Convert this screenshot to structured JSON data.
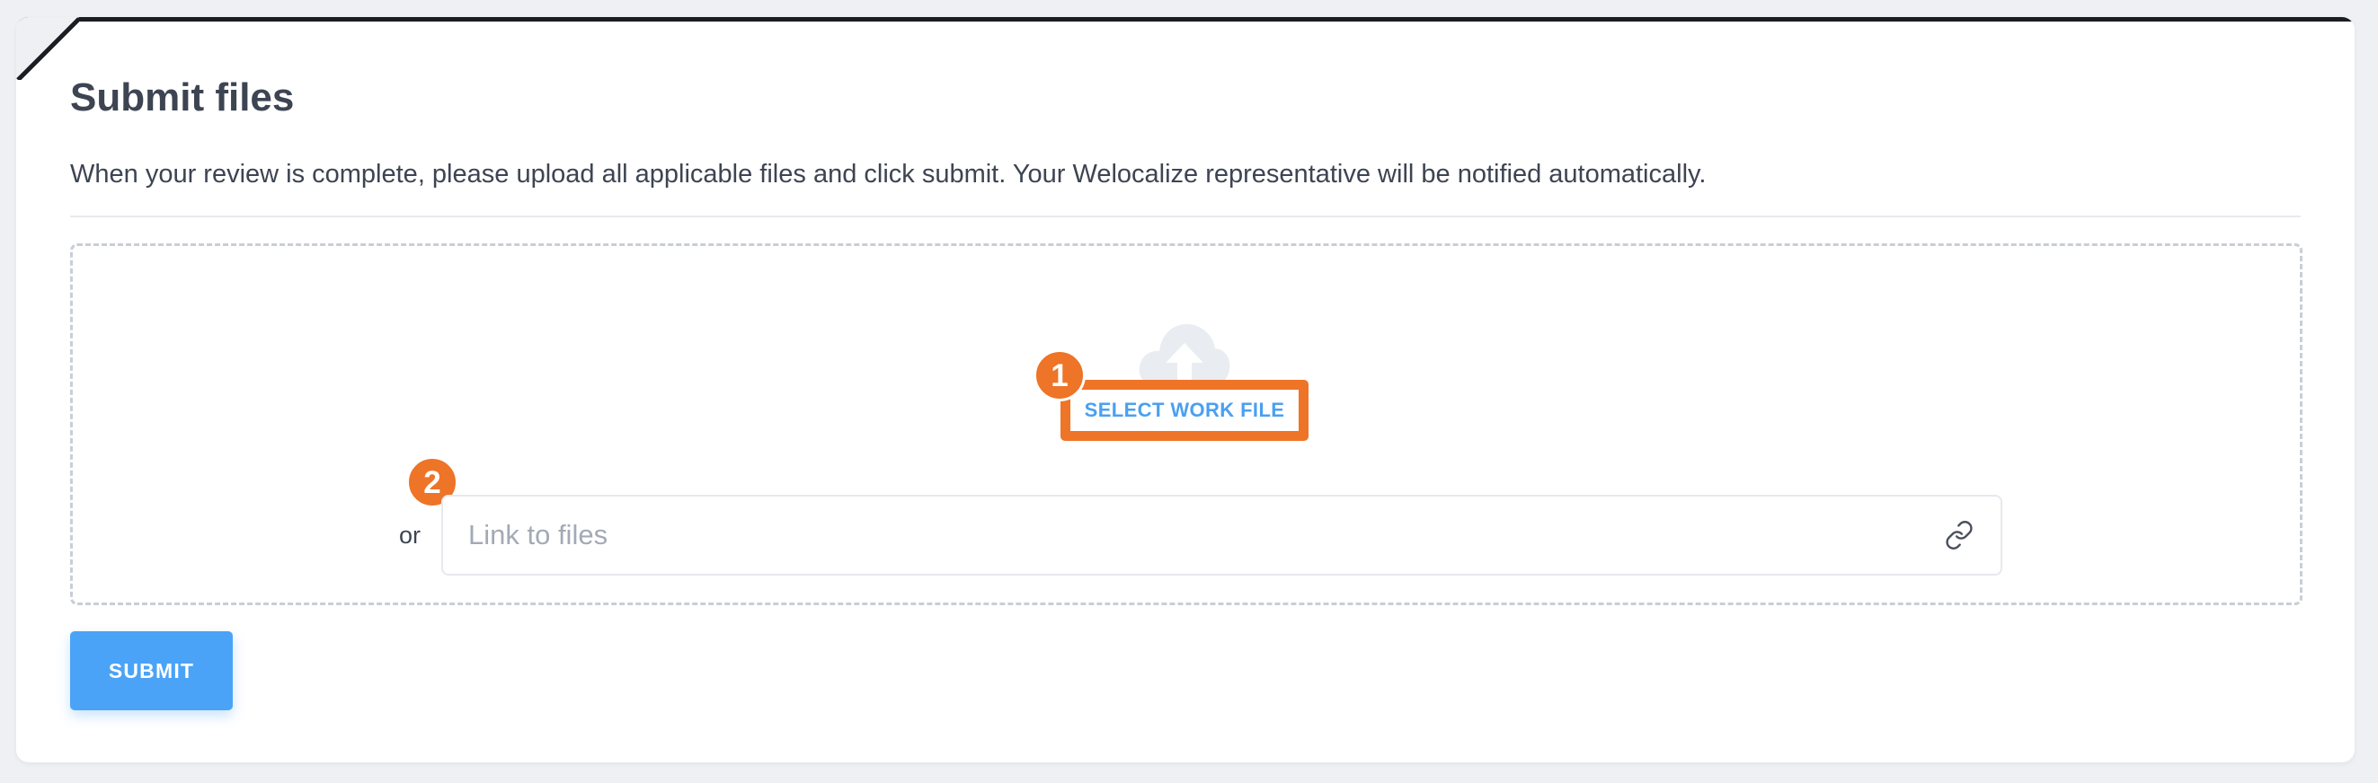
{
  "panel": {
    "title": "Submit files",
    "description": "When your review is complete, please upload all applicable files and click submit. Your Welocalize representative will be notified automatically."
  },
  "upload": {
    "icon": "cloud-upload-icon",
    "select_file_label": "SELECT WORK FILE",
    "or_label": "or",
    "link_placeholder": "Link to files",
    "link_value": "",
    "link_icon": "link-icon"
  },
  "annotations": {
    "badge_1": "1",
    "badge_2": "2"
  },
  "actions": {
    "submit_label": "SUBMIT"
  },
  "colors": {
    "accent": "#4aa3f7",
    "annotation": "#ee7427",
    "text": "#3d4452",
    "placeholder": "#a3aab6",
    "border_dashed": "#c9ced6"
  }
}
